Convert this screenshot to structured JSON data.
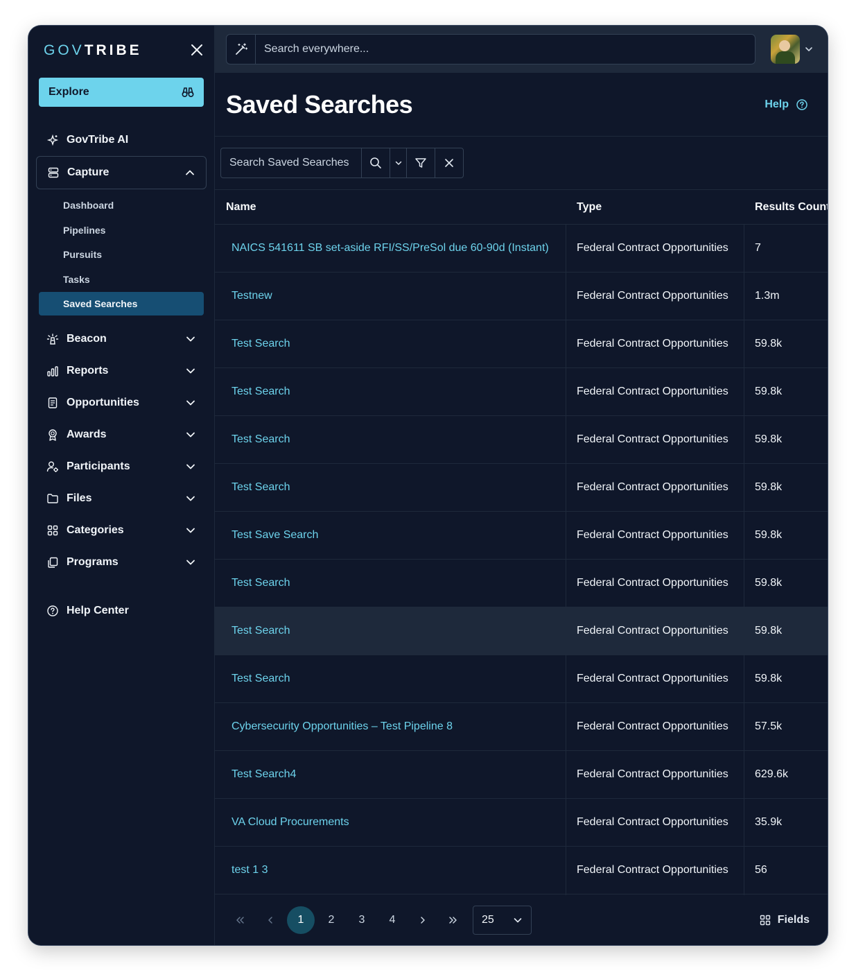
{
  "brand": {
    "part1": "GOV",
    "part2": "TRIBE"
  },
  "sidebar": {
    "explore_label": "Explore",
    "ai_label": "GovTribe AI",
    "capture": {
      "label": "Capture",
      "items": [
        "Dashboard",
        "Pipelines",
        "Pursuits",
        "Tasks",
        "Saved Searches"
      ]
    },
    "sections": [
      "Beacon",
      "Reports",
      "Opportunities",
      "Awards",
      "Participants",
      "Files",
      "Categories",
      "Programs"
    ],
    "help_center": "Help Center"
  },
  "topbar": {
    "search_placeholder": "Search everywhere..."
  },
  "page": {
    "title": "Saved Searches",
    "help_label": "Help"
  },
  "toolbar": {
    "search_placeholder": "Search Saved Searches"
  },
  "table": {
    "columns": [
      "Name",
      "Type",
      "Results Count"
    ],
    "rows": [
      {
        "name": "NAICS 541611 SB set-aside RFI/SS/PreSol due 60-90d (Instant)",
        "type": "Federal Contract Opportunities",
        "count": "7"
      },
      {
        "name": "Testnew",
        "type": "Federal Contract Opportunities",
        "count": "1.3m"
      },
      {
        "name": "Test Search",
        "type": "Federal Contract Opportunities",
        "count": "59.8k"
      },
      {
        "name": "Test Search",
        "type": "Federal Contract Opportunities",
        "count": "59.8k"
      },
      {
        "name": "Test Search",
        "type": "Federal Contract Opportunities",
        "count": "59.8k"
      },
      {
        "name": "Test Search",
        "type": "Federal Contract Opportunities",
        "count": "59.8k"
      },
      {
        "name": "Test Save Search",
        "type": "Federal Contract Opportunities",
        "count": "59.8k"
      },
      {
        "name": "Test Search",
        "type": "Federal Contract Opportunities",
        "count": "59.8k"
      },
      {
        "name": "Test Search",
        "type": "Federal Contract Opportunities",
        "count": "59.8k"
      },
      {
        "name": "Test Search",
        "type": "Federal Contract Opportunities",
        "count": "59.8k"
      },
      {
        "name": "Cybersecurity Opportunities – Test Pipeline 8",
        "type": "Federal Contract Opportunities",
        "count": "57.5k"
      },
      {
        "name": "Test Search4",
        "type": "Federal Contract Opportunities",
        "count": "629.6k"
      },
      {
        "name": "VA Cloud Procurements",
        "type": "Federal Contract Opportunities",
        "count": "35.9k"
      },
      {
        "name": "test 1 3",
        "type": "Federal Contract Opportunities",
        "count": "56"
      }
    ]
  },
  "pagination": {
    "pages": [
      "1",
      "2",
      "3",
      "4"
    ],
    "current": "1",
    "per_page": "25",
    "fields_label": "Fields"
  },
  "colors": {
    "accent": "#6dd3ec",
    "background": "#0f172a",
    "surface": "#1e293b",
    "active": "#164e73"
  }
}
